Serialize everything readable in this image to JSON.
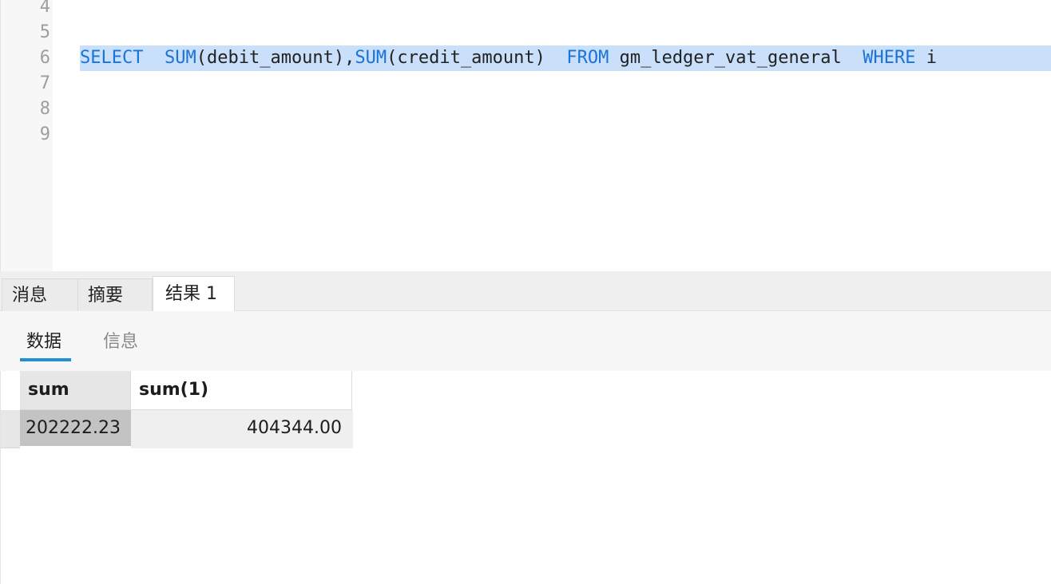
{
  "editor": {
    "lines": [
      {
        "number": "4",
        "text": ""
      },
      {
        "number": "5",
        "text": ""
      },
      {
        "number": "6",
        "text": "SELECT  SUM(debit_amount),SUM(credit_amount)  FROM gm_ledger_vat_general  WHERE i"
      },
      {
        "number": "7",
        "text": ""
      },
      {
        "number": "8",
        "text": ""
      },
      {
        "number": "9",
        "text": ""
      }
    ],
    "sql_tokens": {
      "select": "SELECT",
      "gap1": "  ",
      "sum1": "SUM",
      "arg1": "(debit_amount),",
      "sum2": "SUM",
      "arg2": "(credit_amount)",
      "gap2": "  ",
      "from": "FROM",
      "table": " gm_ledger_vat_general  ",
      "where": "WHERE",
      "rest": " i"
    },
    "keyword_color": "#1a73d9",
    "selection_color": "#c9dffa"
  },
  "result_tabs": [
    {
      "label": "消息",
      "active": false
    },
    {
      "label": "摘要",
      "active": false
    },
    {
      "label": "结果 1",
      "active": true
    }
  ],
  "sub_tabs": [
    {
      "label": "数据",
      "active": true
    },
    {
      "label": "信息",
      "active": false
    }
  ],
  "accent_color": "#1e90d6",
  "grid": {
    "columns": [
      "sum",
      "sum(1)"
    ],
    "rows": [
      [
        "202222.23",
        "404344.00"
      ]
    ]
  }
}
